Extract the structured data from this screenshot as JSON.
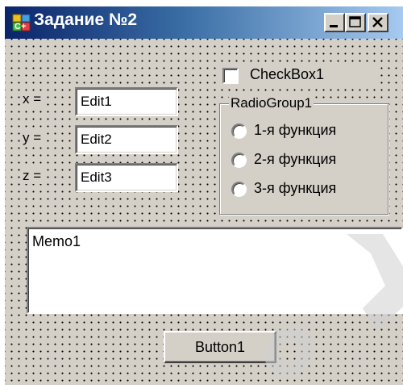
{
  "window": {
    "title": "Задание №2",
    "icon": "cpp-builder-app-icon",
    "controls": {
      "minimize": "minimize-icon",
      "maximize": "maximize-icon",
      "close": "close-icon"
    }
  },
  "labels": {
    "x": "x =",
    "y": "y =",
    "z": "z ="
  },
  "edits": {
    "edit1": "Edit1",
    "edit2": "Edit2",
    "edit3": "Edit3"
  },
  "checkbox": {
    "label": "CheckBox1",
    "checked": false
  },
  "radio_group": {
    "caption": "RadioGroup1",
    "items": [
      {
        "label": "1-я функция",
        "selected": false
      },
      {
        "label": "2-я функция",
        "selected": false
      },
      {
        "label": "3-я функция",
        "selected": false
      }
    ]
  },
  "memo": {
    "text": "Memo1"
  },
  "button": {
    "label": "Button1"
  },
  "colors": {
    "window_face": "#d4d0c8",
    "title_gradient_start": "#0a246a",
    "title_gradient_end": "#a6caf0"
  }
}
